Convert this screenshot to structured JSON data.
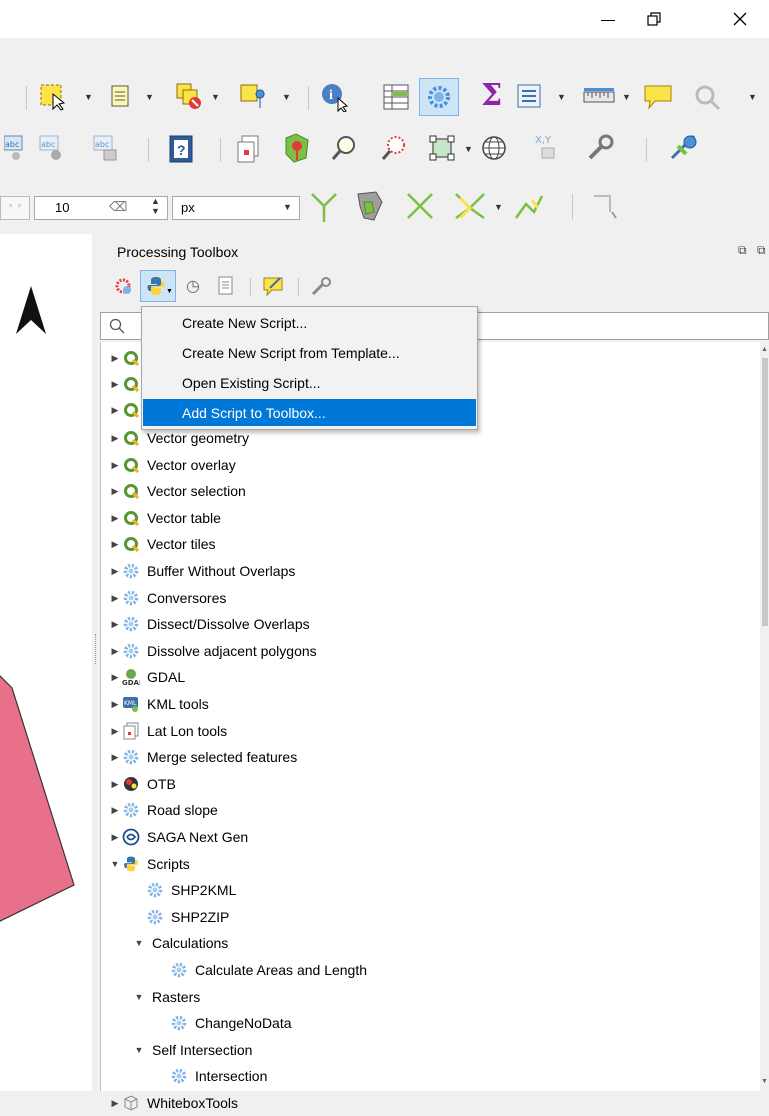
{
  "window": {
    "minimize_glyph": "–",
    "restore_glyph": "❐",
    "close_glyph": "✕"
  },
  "toolbar3": {
    "size_value": "10",
    "unit_value": "px"
  },
  "panel": {
    "title": "Processing Toolbox"
  },
  "menu": {
    "items": [
      {
        "label": "Create New Script..."
      },
      {
        "label": "Create New Script from Template..."
      },
      {
        "label": "Open Existing Script..."
      },
      {
        "label": "Add Script to Toolbox...",
        "highlighted": true
      }
    ]
  },
  "tree": {
    "rows": [
      {
        "label": "Vector geometry",
        "icon": "qgis-icon"
      },
      {
        "label": "Vector overlay",
        "icon": "qgis-icon"
      },
      {
        "label": "Vector selection",
        "icon": "qgis-icon"
      },
      {
        "label": "Vector table",
        "icon": "qgis-icon"
      },
      {
        "label": "Vector tiles",
        "icon": "qgis-icon"
      },
      {
        "label": "Buffer Without Overlaps",
        "icon": "gear-icon"
      },
      {
        "label": "Conversores",
        "icon": "gear-icon"
      },
      {
        "label": "Dissect/Dissolve Overlaps",
        "icon": "gear-icon"
      },
      {
        "label": "Dissolve adjacent polygons",
        "icon": "gear-icon"
      },
      {
        "label": "GDAL",
        "icon": "gdal-icon"
      },
      {
        "label": "KML tools",
        "icon": "kml-icon"
      },
      {
        "label": "Lat Lon tools",
        "icon": "latlon-icon"
      },
      {
        "label": "Merge selected features",
        "icon": "gear-icon"
      },
      {
        "label": "OTB",
        "icon": "otb-icon"
      },
      {
        "label": "Road slope",
        "icon": "gear-icon"
      },
      {
        "label": "SAGA Next Gen",
        "icon": "saga-icon"
      },
      {
        "label": "Scripts",
        "icon": "python-icon"
      },
      {
        "label": "SHP2KML",
        "icon": "gear-icon"
      },
      {
        "label": "SHP2ZIP",
        "icon": "gear-icon"
      },
      {
        "label": "Calculations",
        "icon": ""
      },
      {
        "label": "Calculate Areas and Length",
        "icon": "gear-icon"
      },
      {
        "label": "Rasters",
        "icon": ""
      },
      {
        "label": "ChangeNoData",
        "icon": "gear-icon"
      },
      {
        "label": "Self Intersection",
        "icon": ""
      },
      {
        "label": "Intersection",
        "icon": "gear-icon"
      },
      {
        "label": "WhiteboxTools",
        "icon": "whitebox-icon"
      }
    ]
  },
  "colors": {
    "selection": "#0078d7",
    "qgis_green": "#589632",
    "gear_blue": "#7fb2e5",
    "polygon_fill": "#e8708a"
  }
}
